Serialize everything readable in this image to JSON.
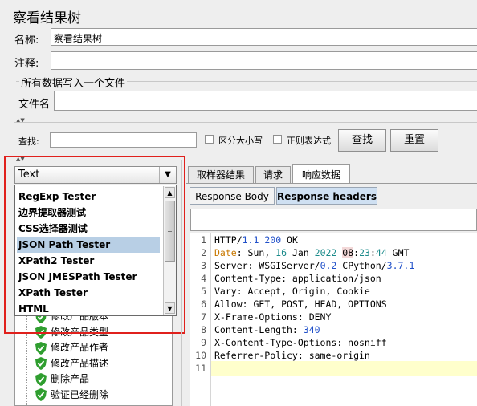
{
  "panel": {
    "title": "察看结果树",
    "name_label": "名称:",
    "name_value": "察看结果树",
    "comment_label": "注释:",
    "comment_value": "",
    "file_group_title": "所有数据写入一个文件",
    "filename_label": "文件名",
    "filename_value": ""
  },
  "search": {
    "label": "查找:",
    "value": "",
    "case_sensitive_label": "区分大小写",
    "regex_label": "正则表达式",
    "find_button": "查找",
    "reset_button": "重置"
  },
  "renderer": {
    "selected": "Text",
    "options": [
      "RegExp Tester",
      "边界提取器测试",
      "CSS选择器测试",
      "JSON Path Tester",
      "XPath2 Tester",
      "JSON JMESPath Tester",
      "XPath Tester",
      "HTML"
    ],
    "highlighted_index": 3
  },
  "tree": {
    "items": [
      {
        "label": "修改产品版本"
      },
      {
        "label": "修改产品类型"
      },
      {
        "label": "修改产品作者"
      },
      {
        "label": "修改产品描述"
      },
      {
        "label": "删除产品"
      },
      {
        "label": "验证已经删除"
      }
    ]
  },
  "result_tabs": [
    "取样器结果",
    "请求",
    "响应数据"
  ],
  "result_active_tab": "响应数据",
  "response_tabs": [
    "Response Body",
    "Response headers"
  ],
  "response_active_tab": "Response headers",
  "response_filter_value": "",
  "code_lines": [
    {
      "n": "1",
      "text": "HTTP/1.1 200 OK"
    },
    {
      "n": "2",
      "text": "Date: Sun, 16 Jan 2022 08:23:44 GMT"
    },
    {
      "n": "3",
      "text": "Server: WSGIServer/0.2 CPython/3.7.1"
    },
    {
      "n": "4",
      "text": "Content-Type: application/json"
    },
    {
      "n": "5",
      "text": "Vary: Accept, Origin, Cookie"
    },
    {
      "n": "6",
      "text": "Allow: GET, POST, HEAD, OPTIONS"
    },
    {
      "n": "7",
      "text": "X-Frame-Options: DENY"
    },
    {
      "n": "8",
      "text": "Content-Length: 340"
    },
    {
      "n": "9",
      "text": "X-Content-Type-Options: nosniff"
    },
    {
      "n": "10",
      "text": "Referrer-Policy: same-origin"
    },
    {
      "n": "11",
      "text": ""
    }
  ],
  "colors": {
    "highlight_border": "#e0201c",
    "selected_row": "#b8cfe5",
    "current_line": "#ffffcc",
    "check_green": "#2f9e2f"
  }
}
